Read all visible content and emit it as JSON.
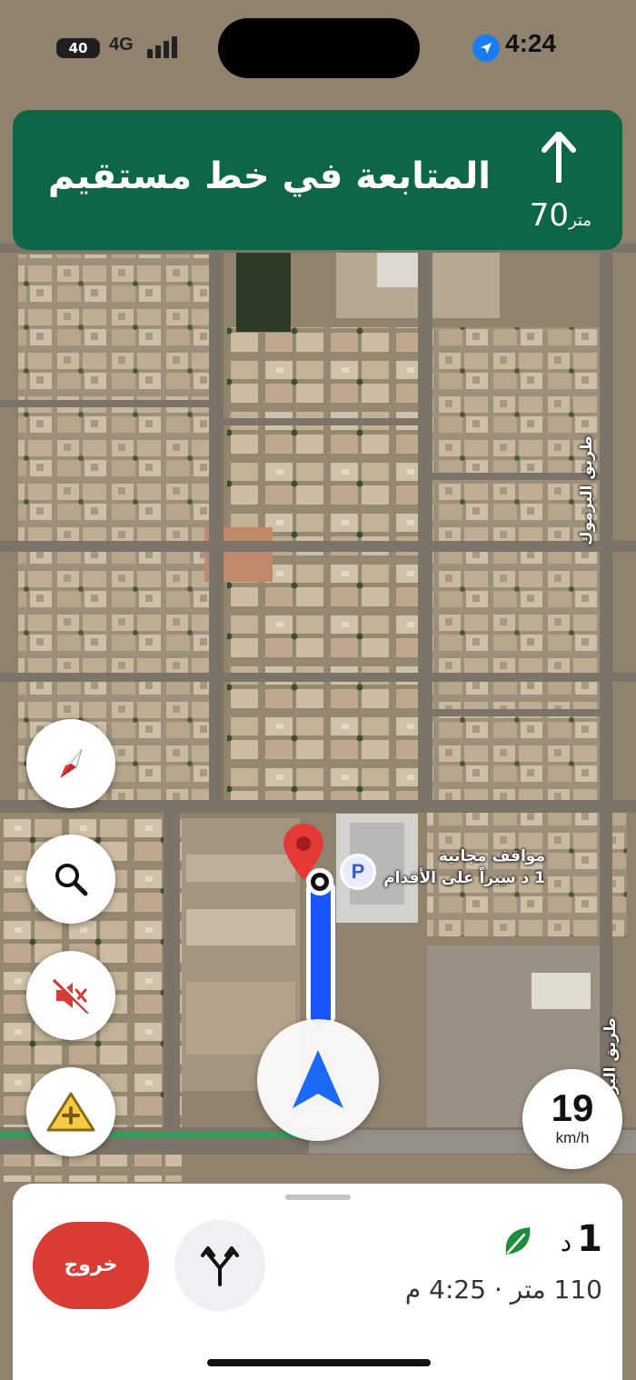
{
  "status_bar": {
    "battery": "40",
    "network": "4G",
    "time": "4:24",
    "location_icon": "location-arrow-icon"
  },
  "banner": {
    "instruction": "المتابعة في خط مستقيم",
    "distance_value": "70",
    "distance_unit": "متر",
    "maneuver_icon": "arrow-straight-icon",
    "color": "#0d6646"
  },
  "map": {
    "parking_label_line1": "مواقف مجانية",
    "parking_label_line2": "1 د سيراً على الأقدام",
    "parking_icon_letter": "P",
    "road_label_1": "طريق اليرموك",
    "road_label_2": "طريق اليرموك",
    "route_color": "#1a56ff"
  },
  "controls": {
    "compass_icon": "compass-icon",
    "search_icon": "search-icon",
    "mute_icon": "sound-off-icon",
    "report_icon": "report-incident-icon",
    "recenter_icon": "navigation-arrow-icon"
  },
  "speed": {
    "value": "19",
    "unit": "km/h"
  },
  "bottom_sheet": {
    "exit_label": "خروج",
    "route_options_icon": "route-options-icon",
    "eta_minutes": "1",
    "eta_minutes_unit": "د",
    "eco_icon": "eco-leaf-icon",
    "details": "110 متر · 4:25 م"
  }
}
